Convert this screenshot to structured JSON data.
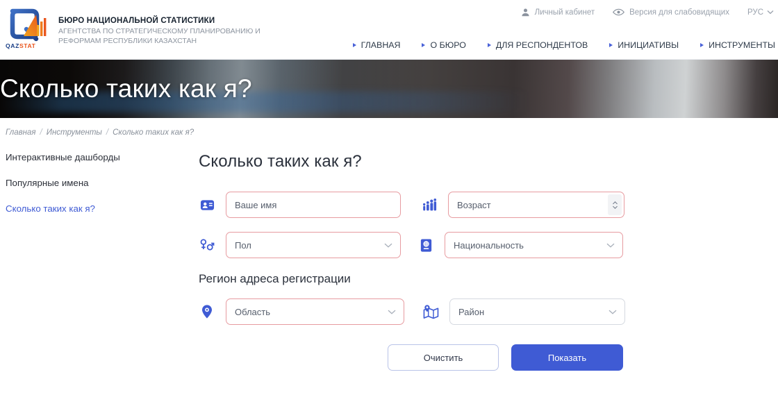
{
  "header": {
    "logo_text": "QAZSTAT",
    "brand_title": "БЮРО НАЦИОНАЛЬНОЙ СТАТИСТИКИ",
    "brand_sub_line1": "АГЕНТСТВА ПО СТРАТЕГИЧЕСКОМУ ПЛАНИРОВАНИЮ И",
    "brand_sub_line2": "РЕФОРМАМ РЕСПУБЛИКИ КАЗАХСТАН",
    "utility": [
      {
        "label": "Личный кабинет",
        "icon": "user-icon"
      },
      {
        "label": "Версия для слабовидящих",
        "icon": "eye-icon"
      }
    ],
    "language": "РУС",
    "nav": [
      {
        "label": "ГЛАВНАЯ"
      },
      {
        "label": "О БЮРО"
      },
      {
        "label": "ДЛЯ РЕСПОНДЕНТОВ"
      },
      {
        "label": "ИНИЦИАТИВЫ"
      },
      {
        "label": "ИНСТРУМЕНТЫ"
      }
    ]
  },
  "hero": {
    "title": "Сколько таких как я?"
  },
  "breadcrumb": {
    "items": [
      "Главная",
      "Инструменты",
      "Сколько таких как я?"
    ],
    "separator": "/"
  },
  "sidebar": {
    "items": [
      {
        "label": "Интерактивные дашборды",
        "active": false
      },
      {
        "label": "Популярные имена",
        "active": false
      },
      {
        "label": "Сколько таких как я?",
        "active": true
      }
    ]
  },
  "main": {
    "page_title": "Сколько таких как я?",
    "section_title": "Регион адреса регистрации",
    "fields": {
      "name": {
        "placeholder": "Ваше имя",
        "icon": "id-card-icon",
        "type": "text",
        "border": "#e79ba0"
      },
      "age": {
        "placeholder": "Возраст",
        "icon": "people-ages-icon",
        "type": "number",
        "border": "#e79ba0"
      },
      "sex": {
        "placeholder": "Пол",
        "icon": "gender-icon",
        "type": "select",
        "border": "#e79ba0"
      },
      "nationality": {
        "placeholder": "Национальность",
        "icon": "passport-icon",
        "type": "select",
        "border": "#e79ba0"
      },
      "region": {
        "placeholder": "Область",
        "icon": "map-pin-icon",
        "type": "select",
        "border": "#e79ba0"
      },
      "district": {
        "placeholder": "Район",
        "icon": "map-area-icon",
        "type": "select",
        "border": "#d5d9e0"
      }
    },
    "buttons": {
      "clear": "Очистить",
      "submit": "Показать"
    }
  },
  "colors": {
    "accent_blue": "#3f5bd4",
    "error_border": "#e79ba0",
    "neutral_border": "#d5d9e0",
    "logo_orange": "#f28a1e",
    "logo_blue": "#2a4fa3"
  }
}
